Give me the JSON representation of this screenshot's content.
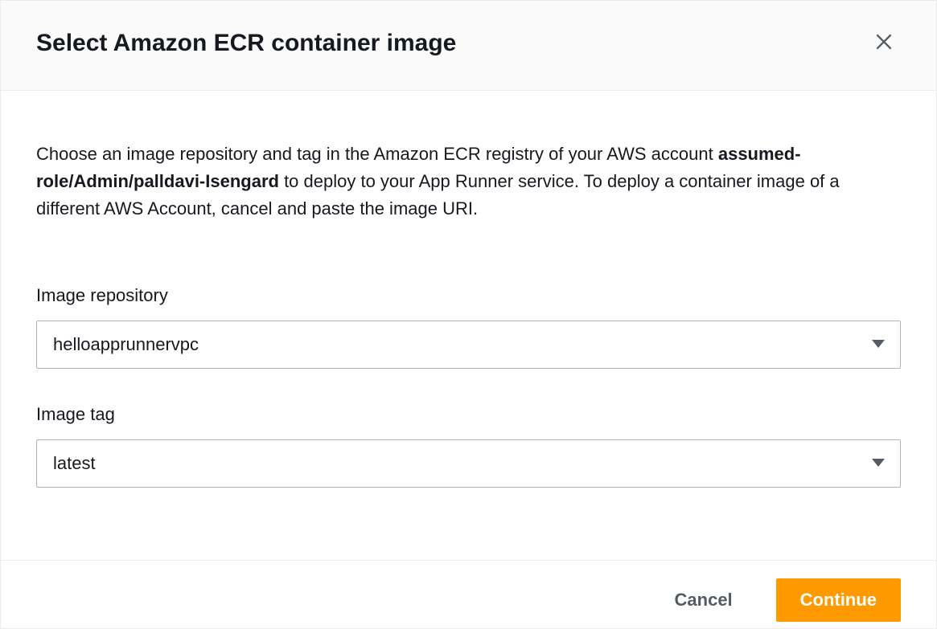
{
  "modal": {
    "title": "Select Amazon ECR container image",
    "description_prefix": "Choose an image repository and tag in the Amazon ECR registry of your AWS account ",
    "description_bold": "assumed-role/Admin/palldavi-Isengard",
    "description_suffix": " to deploy to your App Runner service. To deploy a container image of a different AWS Account, cancel and paste the image URI."
  },
  "form": {
    "repository_label": "Image repository",
    "repository_value": "helloapprunnervpc",
    "tag_label": "Image tag",
    "tag_value": "latest"
  },
  "footer": {
    "cancel_label": "Cancel",
    "continue_label": "Continue"
  }
}
